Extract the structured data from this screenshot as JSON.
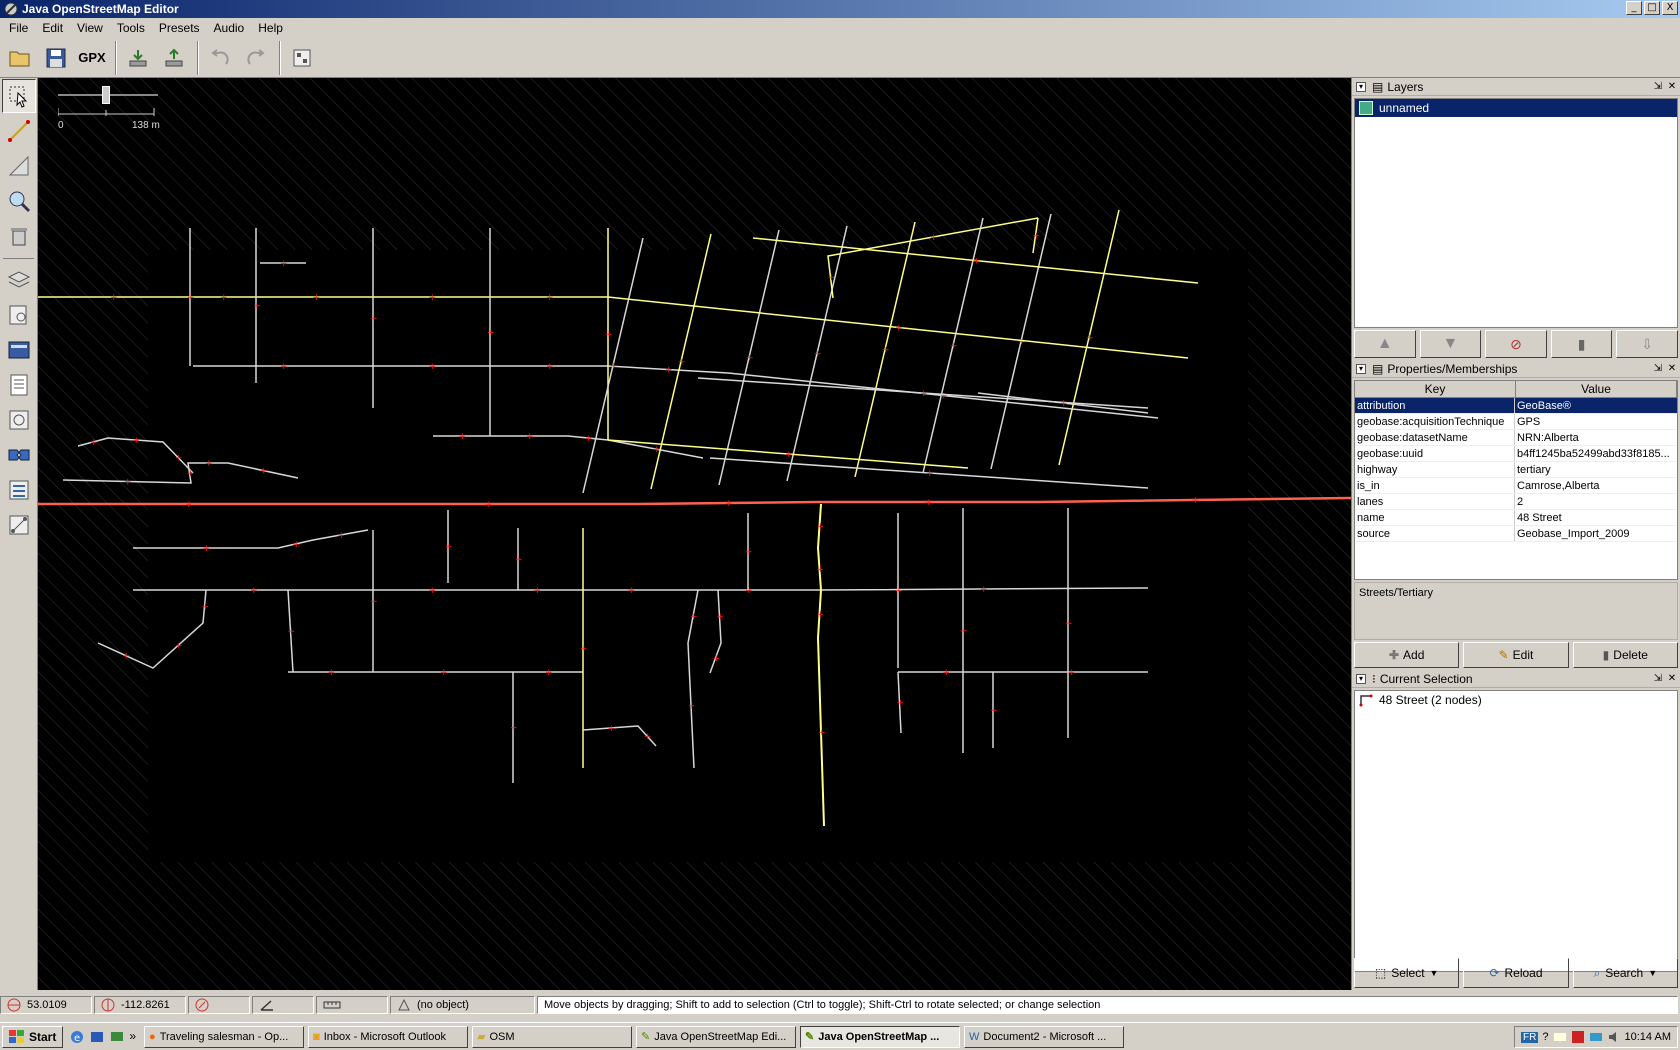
{
  "window": {
    "title": "Java OpenStreetMap Editor",
    "buttons": [
      "_",
      "□",
      "X"
    ]
  },
  "menubar": [
    "File",
    "Edit",
    "View",
    "Tools",
    "Presets",
    "Audio",
    "Help"
  ],
  "toolbar": {
    "gpx_label": "GPX"
  },
  "map": {
    "scale_min": "0",
    "scale_max": "138 m"
  },
  "layers": {
    "title": "Layers",
    "items": [
      "unnamed"
    ]
  },
  "properties": {
    "title": "Properties/Memberships",
    "columns": [
      "Key",
      "Value"
    ],
    "rows": [
      {
        "k": "attribution",
        "v": "GeoBase®"
      },
      {
        "k": "geobase:acquisitionTechnique",
        "v": "GPS"
      },
      {
        "k": "geobase:datasetName",
        "v": "NRN:Alberta"
      },
      {
        "k": "geobase:uuid",
        "v": "b4ff1245ba52499abd33f8185..."
      },
      {
        "k": "highway",
        "v": "tertiary"
      },
      {
        "k": "is_in",
        "v": "Camrose,Alberta"
      },
      {
        "k": "lanes",
        "v": "2"
      },
      {
        "k": "name",
        "v": "48 Street"
      },
      {
        "k": "source",
        "v": "Geobase_Import_2009"
      }
    ],
    "preset": "Streets/Tertiary",
    "add_label": "Add",
    "edit_label": "Edit",
    "delete_label": "Delete"
  },
  "current_selection": {
    "title": "Current Selection",
    "items": [
      "48 Street (2 nodes)"
    ],
    "select_label": "Select",
    "reload_label": "Reload",
    "search_label": "Search"
  },
  "status": {
    "lat": "53.0109",
    "lon": "-112.8261",
    "object": "(no object)",
    "help": "Move objects by dragging; Shift to add to selection (Ctrl to toggle); Shift-Ctrl to rotate selected; or change selection"
  },
  "taskbar": {
    "start": "Start",
    "tasks": [
      {
        "label": "Traveling salesman - Op...",
        "active": false
      },
      {
        "label": "Inbox - Microsoft Outlook",
        "active": false
      },
      {
        "label": "OSM",
        "active": false
      },
      {
        "label": "Java OpenStreetMap Edi...",
        "active": false
      },
      {
        "label": "Java OpenStreetMap ...",
        "active": true
      },
      {
        "label": "Document2 - Microsoft ...",
        "active": false
      }
    ],
    "lang": "FR",
    "clock": "10:14 AM"
  },
  "colors": {
    "selected": "#0a246a",
    "way": "#d8d8d8",
    "tertiary": "#ffff88",
    "primary": "#ff6050",
    "node": "#ff2020"
  }
}
